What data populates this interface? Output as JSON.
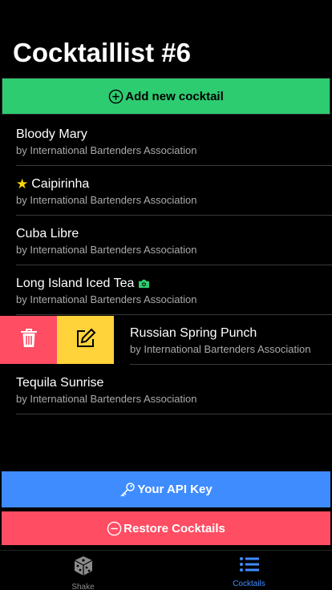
{
  "page": {
    "title": "Cocktaillist #6"
  },
  "actions": {
    "add_label": "Add new cocktail",
    "api_key_label": "Your API Key",
    "restore_label": "Restore Cocktails"
  },
  "cocktails": [
    {
      "name": "Bloody Mary",
      "author": "by International Bartenders Association",
      "favorite": false,
      "has_photo": false
    },
    {
      "name": "Caipirinha",
      "author": "by International Bartenders Association",
      "favorite": true,
      "has_photo": false
    },
    {
      "name": "Cuba Libre",
      "author": "by International Bartenders Association",
      "favorite": false,
      "has_photo": false
    },
    {
      "name": "Long Island Iced Tea",
      "author": "by International Bartenders Association",
      "favorite": false,
      "has_photo": true
    },
    {
      "name": "Russian Spring Punch",
      "author": "by International Bartenders Association",
      "favorite": false,
      "has_photo": false,
      "swiped_open": true
    },
    {
      "name": "Tequila Sunrise",
      "author": "by International Bartenders Association",
      "favorite": false,
      "has_photo": false
    }
  ],
  "tabs": [
    {
      "label": "Shake",
      "icon": "dice-icon",
      "active": false
    },
    {
      "label": "Cocktails",
      "icon": "list-icon",
      "active": true
    }
  ],
  "colors": {
    "add": "#2ecc71",
    "api": "#3f8cff",
    "restore": "#ff4d63",
    "delete": "#ff4d63",
    "edit": "#ffd339",
    "star": "#f5d90a",
    "camera": "#2ecc71",
    "active_tab": "#3f8cff"
  }
}
